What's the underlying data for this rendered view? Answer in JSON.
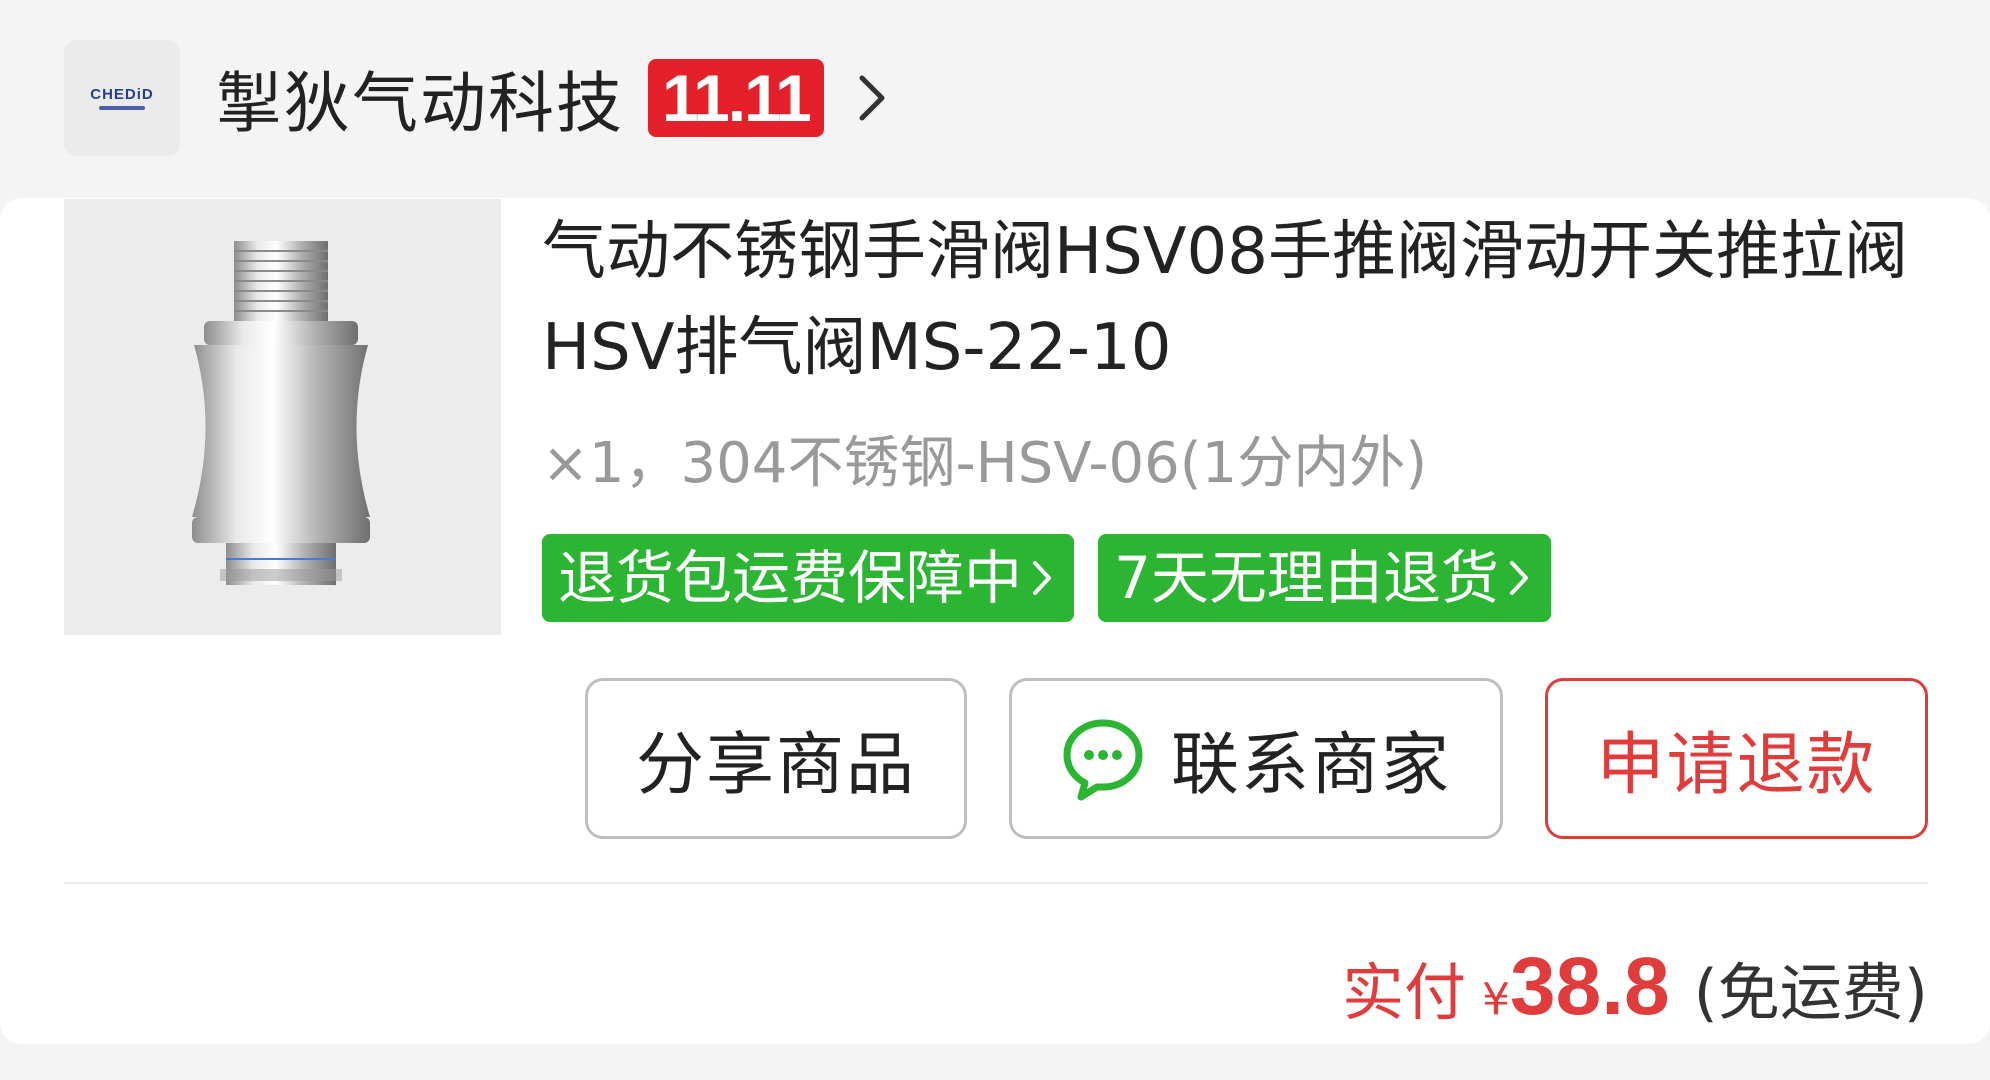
{
  "shop": {
    "logo_text": "CHEDiD",
    "name": "掣狄气动科技",
    "promo_badge": "11.11"
  },
  "product": {
    "title": "气动不锈钢手滑阀HSV08手推阀滑动开关推拉阀HSV排气阀MS-22-10",
    "spec": "×1，304不锈钢-HSV-06(1分内外)",
    "tags": [
      {
        "label": "退货包运费保障中"
      },
      {
        "label": "7天无理由退货"
      }
    ]
  },
  "actions": {
    "share": "分享商品",
    "contact": "联系商家",
    "refund": "申请退款"
  },
  "payment": {
    "paid_label": "实付",
    "currency": "¥",
    "amount": "38.8",
    "shipping_note": "(免运费)"
  },
  "colors": {
    "accent_red": "#e03c3c",
    "badge_red": "#e4202a",
    "tag_green": "#2bb532",
    "wechat_green": "#2bb532"
  },
  "icons": {
    "shop_arrow": "chevron-right-icon",
    "tag_arrow": "chevron-right-icon",
    "contact": "chat-bubble-icon"
  }
}
